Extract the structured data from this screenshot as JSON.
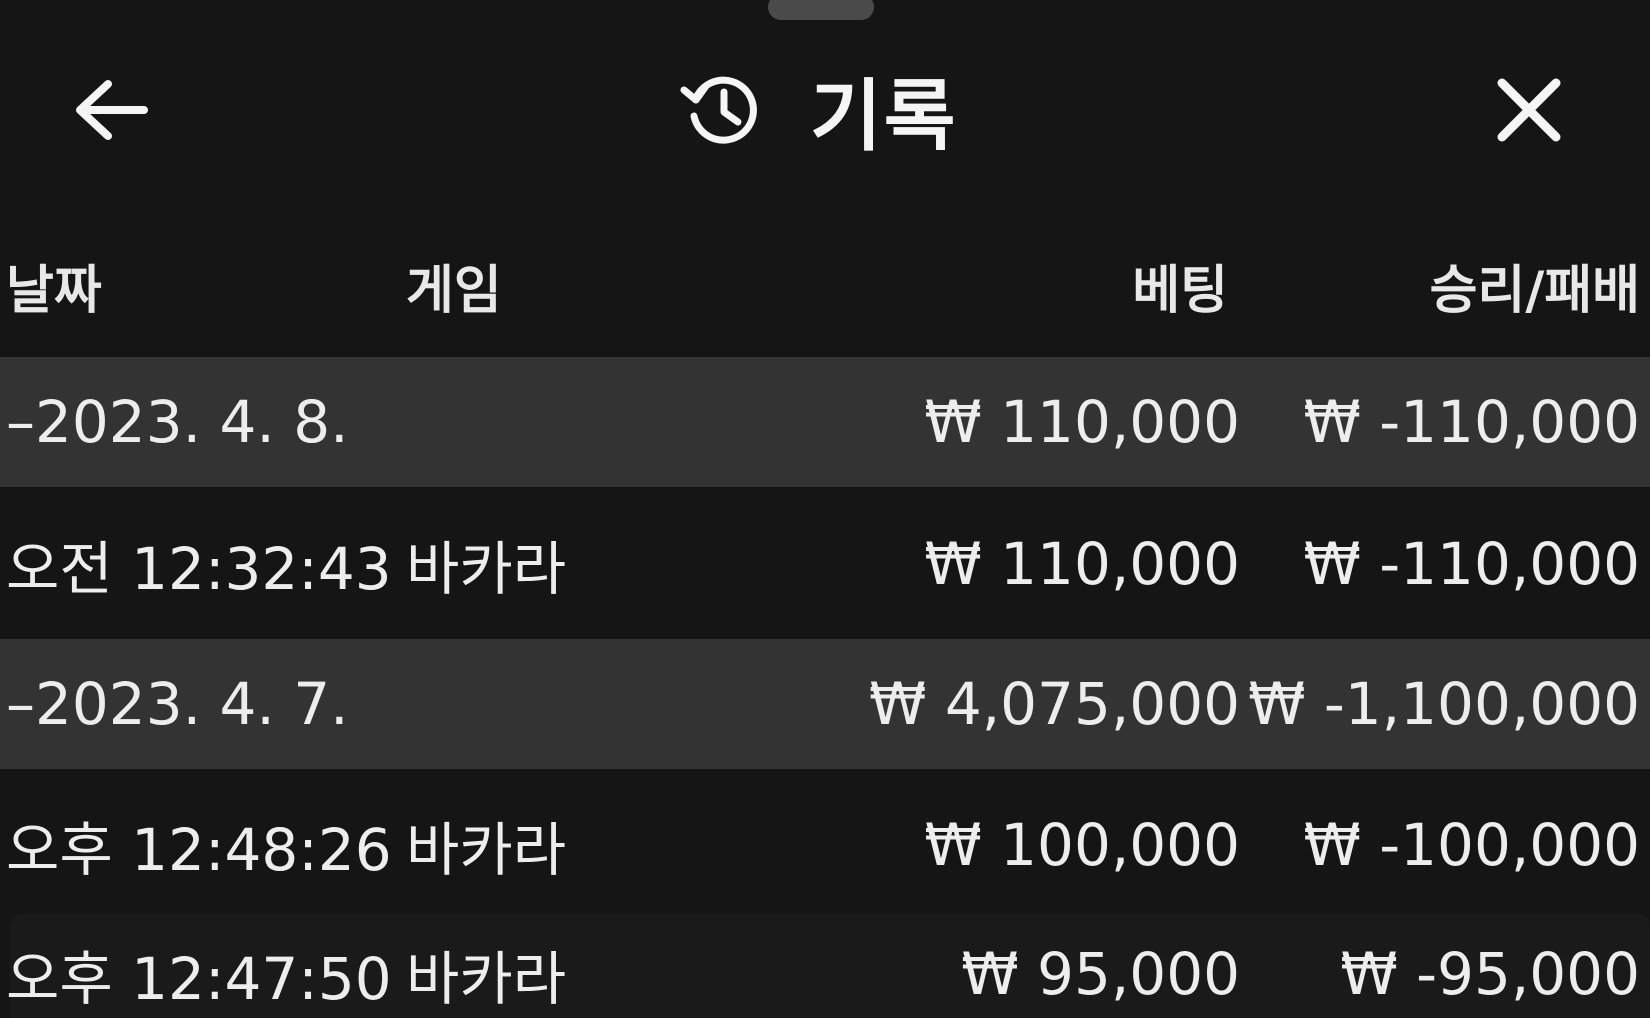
{
  "header": {
    "title": "기록",
    "back_icon": "arrow-left-icon",
    "history_icon": "history-icon",
    "close_icon": "close-icon"
  },
  "columns": {
    "date": "날짜",
    "game": "게임",
    "bet": "베팅",
    "result": "승리/패배"
  },
  "rows": [
    {
      "type": "date",
      "date": "–2023. 4. 8.",
      "game": "",
      "bet": "₩ 110,000",
      "result": "₩ -110,000"
    },
    {
      "type": "entry",
      "date": "오전 12:32:43",
      "game": "바카라",
      "bet": "₩ 110,000",
      "result": "₩ -110,000"
    },
    {
      "type": "date",
      "date": "–2023. 4. 7.",
      "game": "",
      "bet": "₩ 4,075,000",
      "result": "₩ -1,100,000"
    },
    {
      "type": "entry",
      "date": "오후 12:48:26",
      "game": "바카라",
      "bet": "₩ 100,000",
      "result": "₩ -100,000"
    },
    {
      "type": "entry",
      "date": "오후 12:47:50",
      "game": "바카라",
      "bet": "₩ 95,000",
      "result": "₩ -95,000"
    }
  ],
  "colors": {
    "background": "#151515",
    "date_row": "#333333",
    "text": "#ededed"
  }
}
